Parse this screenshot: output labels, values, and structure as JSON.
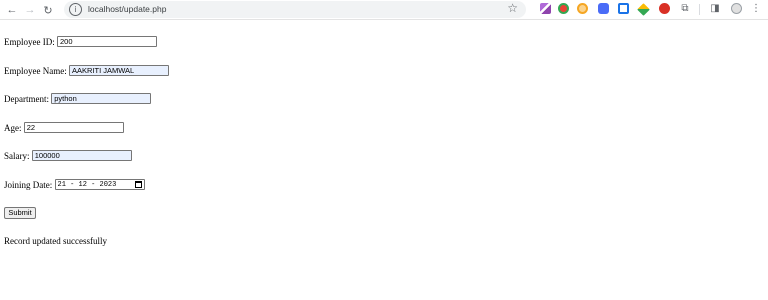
{
  "browser": {
    "url": "localhost/update.php",
    "back_glyph": "←",
    "forward_glyph": "→",
    "reload_glyph": "↻",
    "info_glyph": "i",
    "star_glyph": "☆",
    "menu_glyph": "⋮"
  },
  "form": {
    "employee_id": {
      "label": "Employee ID:",
      "value": "200"
    },
    "employee_name": {
      "label": "Employee Name:",
      "value": "AAKRITI JAMWAL"
    },
    "department": {
      "label": "Department:",
      "value": "python"
    },
    "age": {
      "label": "Age:",
      "value": "22"
    },
    "salary": {
      "label": "Salary:",
      "value": "100000"
    },
    "joining_date": {
      "label": "Joining Date:",
      "value": "21 - 12 - 2023"
    },
    "submit_label": "Submit"
  },
  "status_message": "Record updated successfully",
  "colors": {
    "autofill_bg": "#e8f0fe",
    "extension_colors": [
      "#8e44ad",
      "#ea4335",
      "#f5a623",
      "#4a6cf7",
      "#1a73e8",
      "#fbbc04",
      "#d93025"
    ]
  }
}
